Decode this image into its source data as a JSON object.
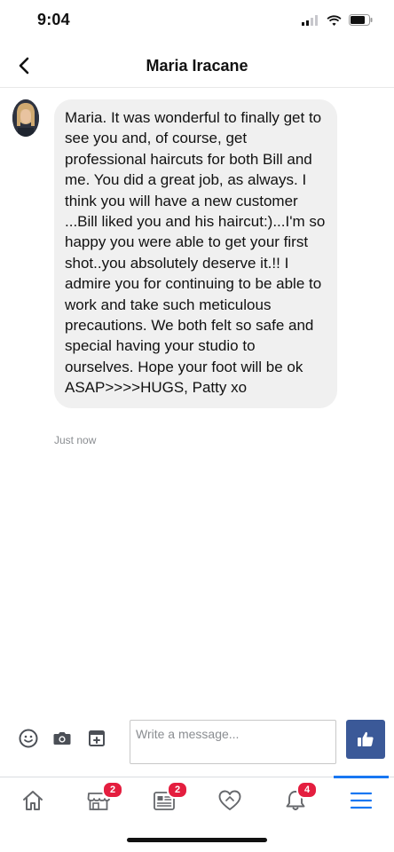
{
  "status_bar": {
    "time": "9:04",
    "icons": [
      "cellular-signal-icon",
      "wifi-icon",
      "battery-icon"
    ]
  },
  "header": {
    "title": "Maria Iracane",
    "back_icon": "chevron-left-icon"
  },
  "conversation": {
    "messages": [
      {
        "text": "Maria. It was wonderful to finally get to see you and, of course, get professional haircuts for both Bill and me. You did a great job, as always. I think you will have a new customer ...Bill liked you and his haircut:)...I'm so happy you were able to get your first shot..you absolutely deserve it.!! I admire you for continuing to be able to work and take such meticulous precautions. We both felt so safe and special having your studio to ourselves. Hope your foot will be ok ASAP>>>>HUGS, Patty xo",
        "timestamp": "Just now"
      }
    ]
  },
  "composer": {
    "placeholder": "Write a message...",
    "value": "",
    "icons": [
      "emoji-icon",
      "camera-icon",
      "sticker-icon",
      "thumbs-up-icon"
    ]
  },
  "bottom_nav": {
    "items": [
      {
        "icon": "home-icon",
        "badge": ""
      },
      {
        "icon": "marketplace-icon",
        "badge": "2"
      },
      {
        "icon": "news-icon",
        "badge": "2"
      },
      {
        "icon": "dating-heart-icon",
        "badge": ""
      },
      {
        "icon": "notifications-bell-icon",
        "badge": "4"
      },
      {
        "icon": "menu-icon",
        "badge": ""
      }
    ],
    "active_index": 5
  },
  "colors": {
    "brand": "#3b5998",
    "accent": "#1877f2",
    "badge": "#e41e3f",
    "bubble": "#f0f0f0",
    "muted_text": "#8a8d91"
  }
}
